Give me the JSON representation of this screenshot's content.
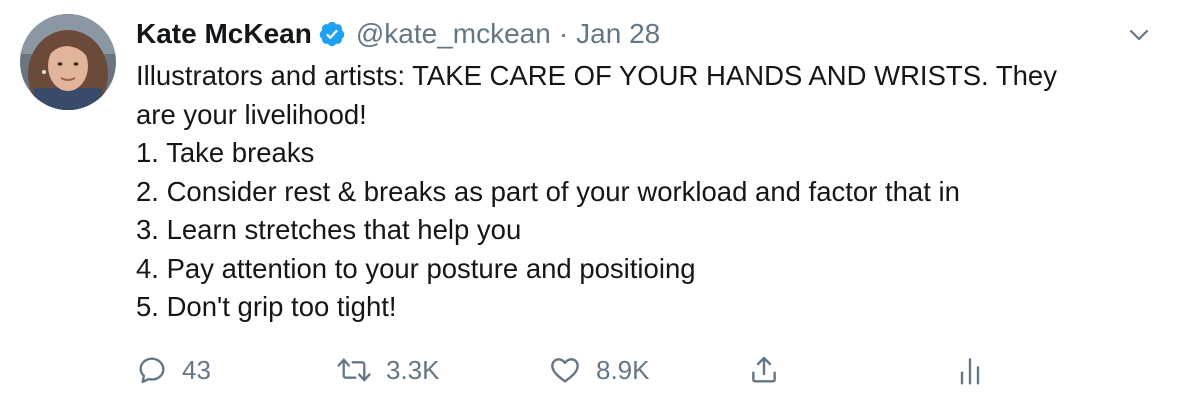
{
  "tweet": {
    "author": {
      "name": "Kate McKean",
      "handle": "@kate_mckean",
      "verified": true
    },
    "separator": "·",
    "date": "Jan 28",
    "lines": [
      "Illustrators and artists: TAKE CARE OF YOUR HANDS AND WRISTS. They",
      "are your livelihood!",
      "1. Take breaks",
      "2. Consider rest & breaks as part of your workload and factor that in",
      "3. Learn stretches that help you",
      "4. Pay attention to your posture and positioing",
      "5. Don't grip too tight!"
    ],
    "actions": {
      "replies": "43",
      "retweets": "3.3K",
      "likes": "8.9K"
    }
  },
  "colors": {
    "verified_badge": "#1da1f2",
    "secondary_text": "#657786",
    "primary_text": "#14171a"
  },
  "icons": {
    "verified": "verified-badge-icon",
    "more": "chevron-down-icon",
    "reply": "reply-icon",
    "retweet": "retweet-icon",
    "like": "heart-icon",
    "share": "share-icon",
    "analytics": "analytics-icon"
  }
}
